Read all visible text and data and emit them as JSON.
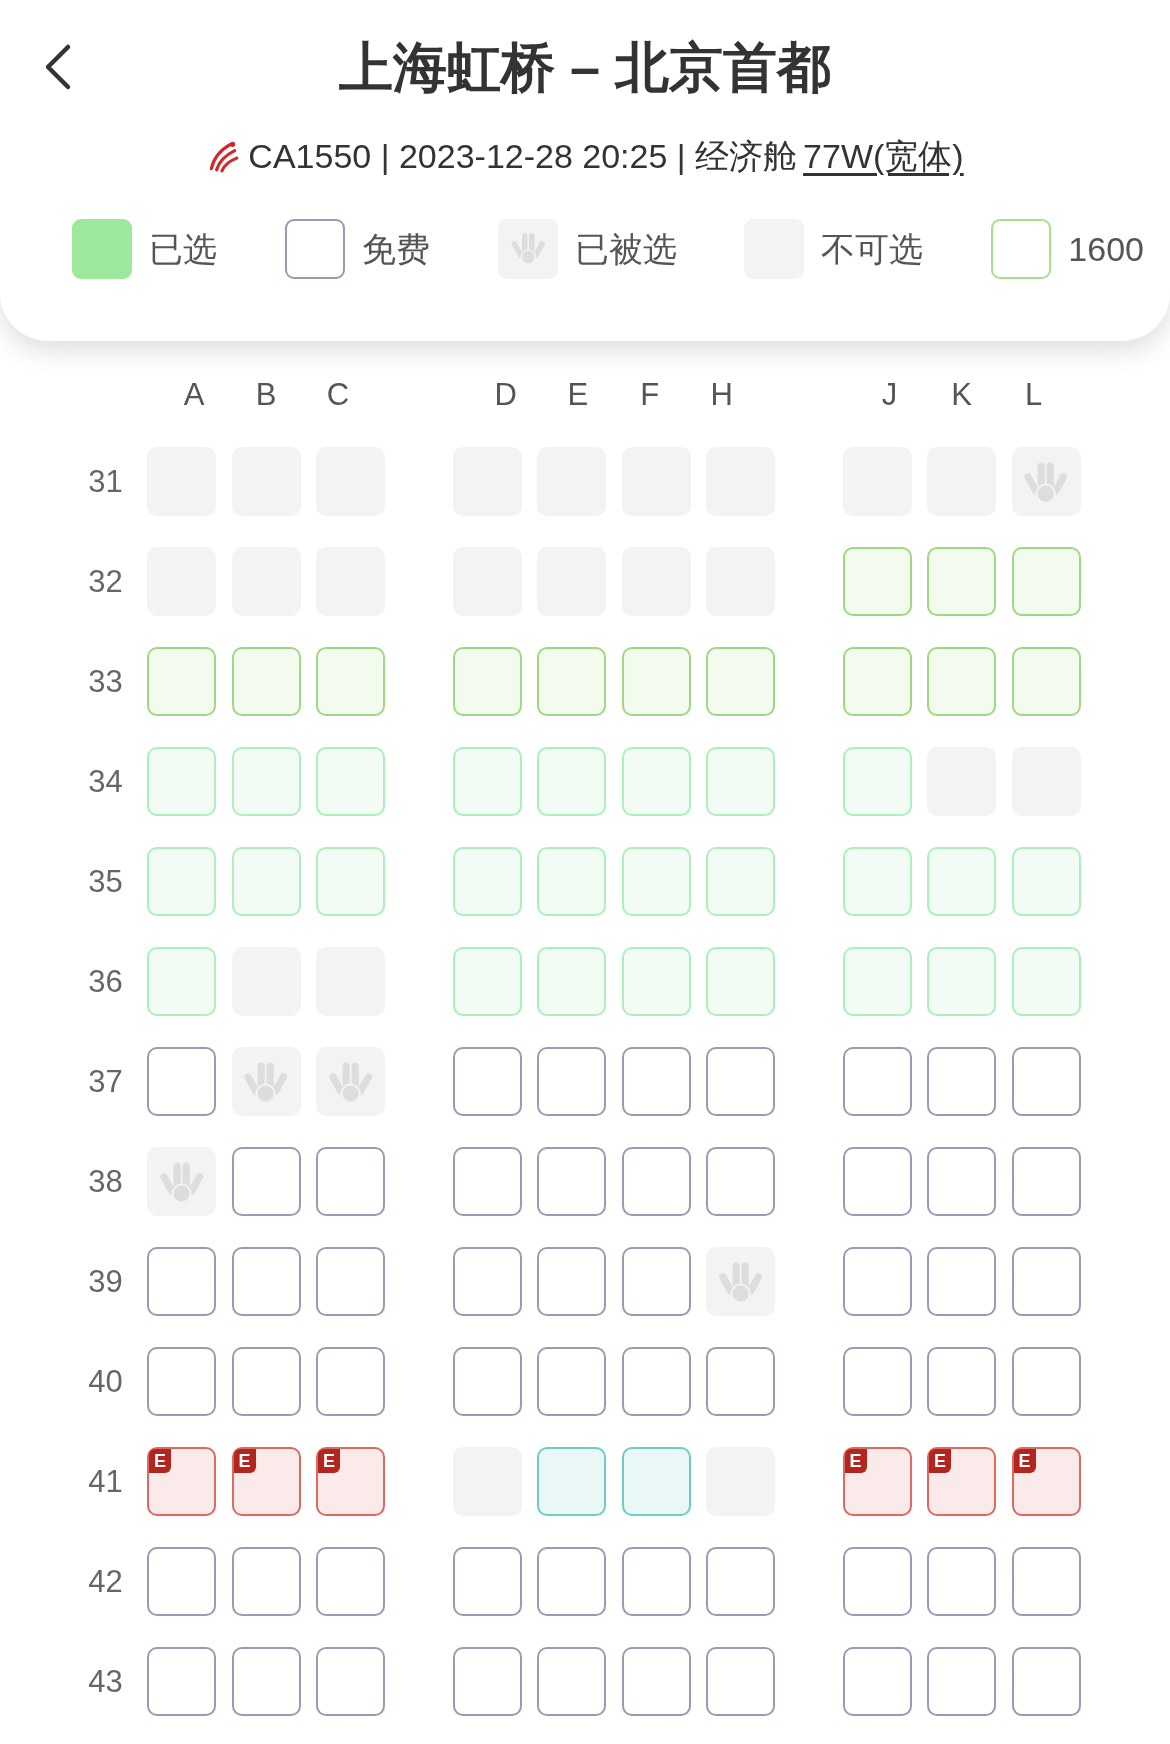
{
  "header": {
    "title": "上海虹桥 – 北京首都",
    "flight": "CA1550 | 2023-12-28 20:25 | 经济舱",
    "aircraft": "77W(宽体)"
  },
  "legend": [
    {
      "kind": "selected",
      "label": "已选"
    },
    {
      "kind": "free",
      "label": "免费"
    },
    {
      "kind": "taken",
      "label": "已被选"
    },
    {
      "kind": "blocked",
      "label": "不可选"
    },
    {
      "kind": "fee",
      "label": "1600"
    }
  ],
  "seat_map": {
    "columns": [
      [
        "A",
        "B",
        "C"
      ],
      [
        "D",
        "E",
        "F",
        "H"
      ],
      [
        "J",
        "K",
        "L"
      ]
    ],
    "rows": [
      {
        "number": "31",
        "seats": [
          [
            {
              "kind": "blocked",
              "selected": false
            },
            {
              "kind": "blocked",
              "selected": false
            },
            {
              "kind": "blocked",
              "selected": false
            }
          ],
          [
            {
              "kind": "blocked",
              "selected": false
            },
            {
              "kind": "blocked",
              "selected": false
            },
            {
              "kind": "blocked",
              "selected": false
            },
            {
              "kind": "blocked",
              "selected": false
            }
          ],
          [
            {
              "kind": "blocked",
              "selected": false
            },
            {
              "kind": "blocked",
              "selected": false
            },
            {
              "kind": "taken",
              "selected": false
            }
          ]
        ]
      },
      {
        "number": "32",
        "seats": [
          [
            {
              "kind": "blocked",
              "selected": false
            },
            {
              "kind": "blocked",
              "selected": false
            },
            {
              "kind": "blocked",
              "selected": false
            }
          ],
          [
            {
              "kind": "blocked",
              "selected": false
            },
            {
              "kind": "blocked",
              "selected": false
            },
            {
              "kind": "blocked",
              "selected": false
            },
            {
              "kind": "blocked",
              "selected": false
            }
          ],
          [
            {
              "kind": "fee",
              "selected": false
            },
            {
              "kind": "fee",
              "selected": false
            },
            {
              "kind": "fee",
              "selected": false
            }
          ]
        ]
      },
      {
        "number": "33",
        "seats": [
          [
            {
              "kind": "fee",
              "selected": false
            },
            {
              "kind": "fee",
              "selected": false
            },
            {
              "kind": "fee",
              "selected": false
            }
          ],
          [
            {
              "kind": "fee",
              "selected": false
            },
            {
              "kind": "fee",
              "selected": false
            },
            {
              "kind": "fee",
              "selected": false
            },
            {
              "kind": "fee",
              "selected": false
            }
          ],
          [
            {
              "kind": "fee",
              "selected": false
            },
            {
              "kind": "fee",
              "selected": false
            },
            {
              "kind": "fee",
              "selected": false
            }
          ]
        ]
      },
      {
        "number": "34",
        "seats": [
          [
            {
              "kind": "plus",
              "selected": false
            },
            {
              "kind": "plus",
              "selected": false
            },
            {
              "kind": "plus",
              "selected": false
            }
          ],
          [
            {
              "kind": "plus",
              "selected": false
            },
            {
              "kind": "plus",
              "selected": false
            },
            {
              "kind": "plus",
              "selected": false
            },
            {
              "kind": "plus",
              "selected": false
            }
          ],
          [
            {
              "kind": "plus",
              "selected": false
            },
            {
              "kind": "blocked",
              "selected": false
            },
            {
              "kind": "blocked",
              "selected": false
            }
          ]
        ]
      },
      {
        "number": "35",
        "seats": [
          [
            {
              "kind": "plus",
              "selected": false
            },
            {
              "kind": "plus",
              "selected": false
            },
            {
              "kind": "plus",
              "selected": false
            }
          ],
          [
            {
              "kind": "plus",
              "selected": false
            },
            {
              "kind": "plus",
              "selected": false
            },
            {
              "kind": "plus",
              "selected": false
            },
            {
              "kind": "plus",
              "selected": false
            }
          ],
          [
            {
              "kind": "plus",
              "selected": false
            },
            {
              "kind": "plus",
              "selected": false
            },
            {
              "kind": "plus",
              "selected": false
            }
          ]
        ]
      },
      {
        "number": "36",
        "seats": [
          [
            {
              "kind": "plus",
              "selected": false
            },
            {
              "kind": "blocked",
              "selected": false
            },
            {
              "kind": "blocked",
              "selected": false
            }
          ],
          [
            {
              "kind": "plus",
              "selected": false
            },
            {
              "kind": "plus",
              "selected": false
            },
            {
              "kind": "plus",
              "selected": false
            },
            {
              "kind": "plus",
              "selected": false
            }
          ],
          [
            {
              "kind": "plus",
              "selected": false
            },
            {
              "kind": "plus",
              "selected": false
            },
            {
              "kind": "plus",
              "selected": false
            }
          ]
        ]
      },
      {
        "number": "37",
        "seats": [
          [
            {
              "kind": "free",
              "selected": false
            },
            {
              "kind": "taken",
              "selected": false
            },
            {
              "kind": "taken",
              "selected": false
            }
          ],
          [
            {
              "kind": "free",
              "selected": false
            },
            {
              "kind": "free",
              "selected": false
            },
            {
              "kind": "free",
              "selected": false
            },
            {
              "kind": "free",
              "selected": false
            }
          ],
          [
            {
              "kind": "free",
              "selected": false
            },
            {
              "kind": "free",
              "selected": false
            },
            {
              "kind": "free",
              "selected": false
            }
          ]
        ]
      },
      {
        "number": "38",
        "seats": [
          [
            {
              "kind": "taken",
              "selected": false
            },
            {
              "kind": "free",
              "selected": false
            },
            {
              "kind": "free",
              "selected": false
            }
          ],
          [
            {
              "kind": "free",
              "selected": false
            },
            {
              "kind": "free",
              "selected": false
            },
            {
              "kind": "free",
              "selected": false
            },
            {
              "kind": "free",
              "selected": false
            }
          ],
          [
            {
              "kind": "free",
              "selected": false
            },
            {
              "kind": "free",
              "selected": false
            },
            {
              "kind": "free",
              "selected": false
            }
          ]
        ]
      },
      {
        "number": "39",
        "seats": [
          [
            {
              "kind": "free",
              "selected": false
            },
            {
              "kind": "free",
              "selected": false
            },
            {
              "kind": "free",
              "selected": false
            }
          ],
          [
            {
              "kind": "free",
              "selected": false
            },
            {
              "kind": "free",
              "selected": false
            },
            {
              "kind": "free",
              "selected": false
            },
            {
              "kind": "taken",
              "selected": false
            }
          ],
          [
            {
              "kind": "free",
              "selected": false
            },
            {
              "kind": "free",
              "selected": false
            },
            {
              "kind": "free",
              "selected": false
            }
          ]
        ]
      },
      {
        "number": "40",
        "seats": [
          [
            {
              "kind": "free",
              "selected": false
            },
            {
              "kind": "free",
              "selected": false
            },
            {
              "kind": "free",
              "selected": false
            }
          ],
          [
            {
              "kind": "free",
              "selected": false
            },
            {
              "kind": "free",
              "selected": false
            },
            {
              "kind": "free",
              "selected": false
            },
            {
              "kind": "free",
              "selected": false
            }
          ],
          [
            {
              "kind": "free",
              "selected": false
            },
            {
              "kind": "free",
              "selected": false
            },
            {
              "kind": "free",
              "selected": false
            }
          ]
        ]
      },
      {
        "number": "41",
        "seats": [
          [
            {
              "kind": "exit",
              "badge": "E",
              "selected": false
            },
            {
              "kind": "exit",
              "badge": "E",
              "selected": false
            },
            {
              "kind": "exit",
              "badge": "E",
              "selected": false
            }
          ],
          [
            {
              "kind": "blocked",
              "selected": false
            },
            {
              "kind": "special",
              "selected": false
            },
            {
              "kind": "special",
              "selected": false
            },
            {
              "kind": "blocked",
              "selected": false
            }
          ],
          [
            {
              "kind": "exit",
              "badge": "E",
              "selected": false
            },
            {
              "kind": "exit",
              "badge": "E",
              "selected": false
            },
            {
              "kind": "exit",
              "badge": "E",
              "selected": false
            }
          ]
        ]
      },
      {
        "number": "42",
        "seats": [
          [
            {
              "kind": "free",
              "selected": false
            },
            {
              "kind": "free",
              "selected": false
            },
            {
              "kind": "free",
              "selected": false
            }
          ],
          [
            {
              "kind": "free",
              "selected": false
            },
            {
              "kind": "free",
              "selected": false
            },
            {
              "kind": "free",
              "selected": false
            },
            {
              "kind": "free",
              "selected": false
            }
          ],
          [
            {
              "kind": "free",
              "selected": false
            },
            {
              "kind": "free",
              "selected": false
            },
            {
              "kind": "free",
              "selected": false
            }
          ]
        ]
      },
      {
        "number": "43",
        "seats": [
          [
            {
              "kind": "free",
              "selected": false
            },
            {
              "kind": "free",
              "selected": false
            },
            {
              "kind": "free",
              "selected": false
            }
          ],
          [
            {
              "kind": "free",
              "selected": false
            },
            {
              "kind": "free",
              "selected": false
            },
            {
              "kind": "free",
              "selected": false
            },
            {
              "kind": "free",
              "selected": false
            }
          ],
          [
            {
              "kind": "free",
              "selected": false
            },
            {
              "kind": "free",
              "selected": false
            },
            {
              "kind": "free",
              "selected": false
            }
          ]
        ]
      }
    ]
  }
}
